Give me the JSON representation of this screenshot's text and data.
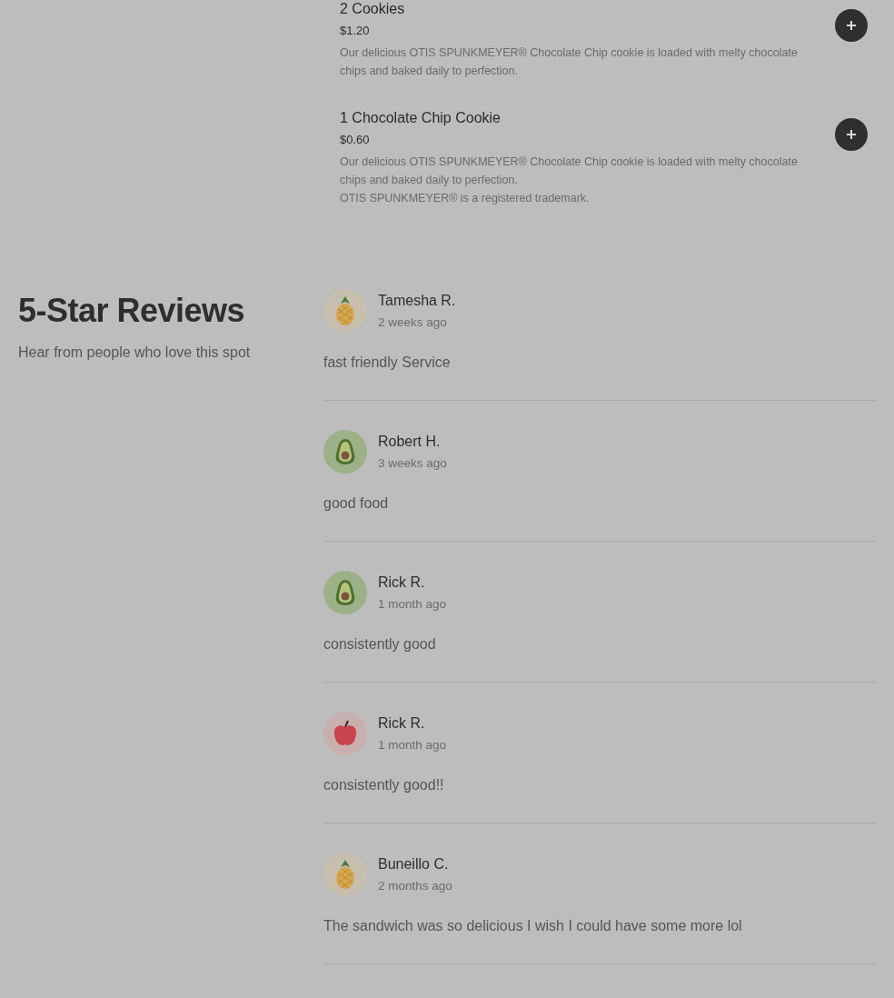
{
  "menu_items": [
    {
      "title": "2 Cookies",
      "price": "$1.20",
      "description": [
        "Our delicious OTIS SPUNKMEYER® Chocolate Chip cookie is loaded with melty chocolate chips and baked daily to perfection."
      ]
    },
    {
      "title": "1 Chocolate Chip Cookie",
      "price": "$0.60",
      "description": [
        "Our delicious OTIS SPUNKMEYER® Chocolate Chip cookie is loaded with melty chocolate chips and baked daily to perfection.",
        "OTIS SPUNKMEYER® is a registered trademark."
      ]
    }
  ],
  "reviews_section": {
    "title": "5-Star Reviews",
    "subtitle": "Hear from people who love this spot"
  },
  "reviews": [
    {
      "name": "Tamesha R.",
      "time": "2 weeks ago",
      "text": "fast friendly Service",
      "avatar": {
        "kind": "pineapple"
      }
    },
    {
      "name": "Robert H.",
      "time": "3 weeks ago",
      "text": "good food",
      "avatar": {
        "kind": "avocado"
      }
    },
    {
      "name": "Rick R.",
      "time": "1 month ago",
      "text": "consistently good",
      "avatar": {
        "kind": "avocado"
      }
    },
    {
      "name": "Rick R.",
      "time": "1 month ago",
      "text": "consistently good!!",
      "avatar": {
        "kind": "apple"
      }
    },
    {
      "name": "Buneillo C.",
      "time": "2 months ago",
      "text": "The sandwich was so delicious I wish I could have some more lol",
      "avatar": {
        "kind": "pineapple"
      }
    }
  ]
}
